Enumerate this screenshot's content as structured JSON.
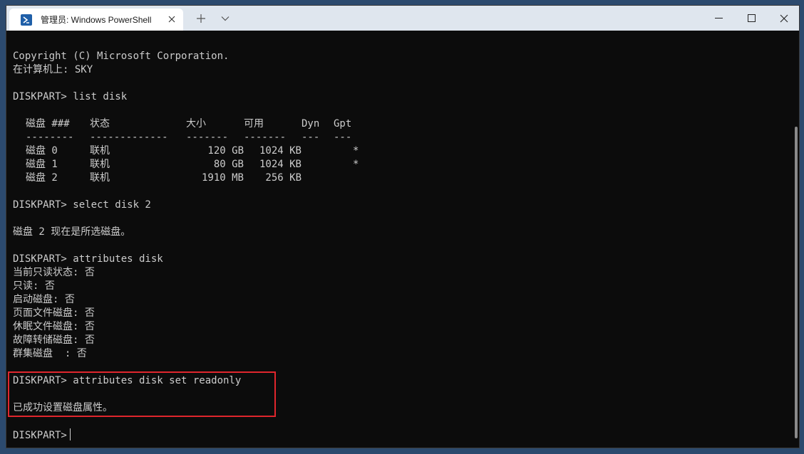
{
  "window": {
    "tab_title": "管理员: Windows PowerShell",
    "tab_close": "✕",
    "new_tab": "+",
    "dropdown": "⌄",
    "minimize": "—",
    "maximize": "☐",
    "close": "✕"
  },
  "terminal": {
    "lines_top": [
      "Copyright (C) Microsoft Corporation.",
      "在计算机上: SKY",
      "",
      "DISKPART> list disk"
    ],
    "table": {
      "headers": {
        "disk": "磁盘 ###",
        "status": "状态",
        "size": "大小",
        "free": "可用",
        "dyn": "Dyn",
        "gpt": "Gpt"
      },
      "separators": {
        "disk": "--------",
        "status": "-------------",
        "size": "-------",
        "free": "-------",
        "dyn": "---",
        "gpt": "---"
      },
      "rows": [
        {
          "disk": "磁盘 0",
          "status": "联机",
          "size": "120 GB",
          "free": "1024 KB",
          "dyn": "",
          "gpt": "*"
        },
        {
          "disk": "磁盘 1",
          "status": "联机",
          "size": "80 GB",
          "free": "1024 KB",
          "dyn": "",
          "gpt": "*"
        },
        {
          "disk": "磁盘 2",
          "status": "联机",
          "size": "1910 MB",
          "free": "256 KB",
          "dyn": "",
          "gpt": ""
        }
      ]
    },
    "lines_middle": [
      "",
      "DISKPART> select disk 2",
      "",
      "磁盘 2 现在是所选磁盘。",
      "",
      "DISKPART> attributes disk",
      "当前只读状态: 否",
      "只读: 否",
      "启动磁盘: 否",
      "页面文件磁盘: 否",
      "休眠文件磁盘: 否",
      "故障转储磁盘: 否",
      "群集磁盘  : 否",
      ""
    ],
    "highlighted_lines": [
      "DISKPART> attributes disk set readonly",
      "",
      "已成功设置磁盘属性。"
    ],
    "prompt": "DISKPART>",
    "highlight_color": "#e0262d"
  }
}
